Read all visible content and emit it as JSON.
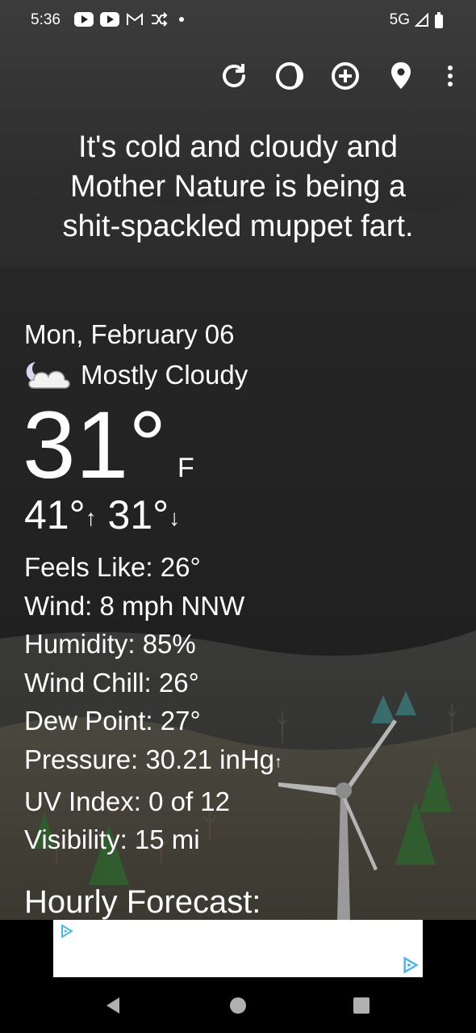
{
  "status_bar": {
    "time": "5:36",
    "network": "5G",
    "left_icons": [
      "youtube-icon",
      "youtube-icon",
      "gmail-icon",
      "shuffle-icon",
      "dot-icon"
    ],
    "right_icons": [
      "signal-icon",
      "battery-icon"
    ]
  },
  "toolbar": {
    "icons": [
      "refresh-icon",
      "theme-icon",
      "add-location-icon",
      "location-pin-icon",
      "more-vert-icon"
    ]
  },
  "headline": {
    "line1": "It's cold and cloudy and",
    "line2": "Mother Nature is being a",
    "line3": "shit-spackled muppet fart."
  },
  "current": {
    "date": "Mon, February 06",
    "condition": "Mostly Cloudy",
    "condition_icon": "partly-cloudy-night-icon",
    "temperature": "31°",
    "unit": "F",
    "high": "41°",
    "low": "31°",
    "high_arrow": "↑",
    "low_arrow": "↓"
  },
  "details": {
    "feels_like": "Feels Like:  26°",
    "wind": "Wind:  8 mph NNW",
    "humidity": "Humidity:  85%",
    "wind_chill": "Wind Chill:  26°",
    "dew_point": "Dew Point:  27°",
    "pressure": "Pressure:  30.21 inHg",
    "pressure_trend": "↑",
    "uv_index": "UV Index:  0 of 12",
    "visibility": "Visibility:  15 mi"
  },
  "hourly": {
    "title": "Hourly Forecast:"
  },
  "colors": {
    "sky_top": "#3b3b3b",
    "sky_bottom": "#1f1f1f",
    "hills": "#4a4840",
    "text": "#ffffff",
    "ad_bar": "#000000",
    "ad_logo": "#4fb3e6"
  }
}
